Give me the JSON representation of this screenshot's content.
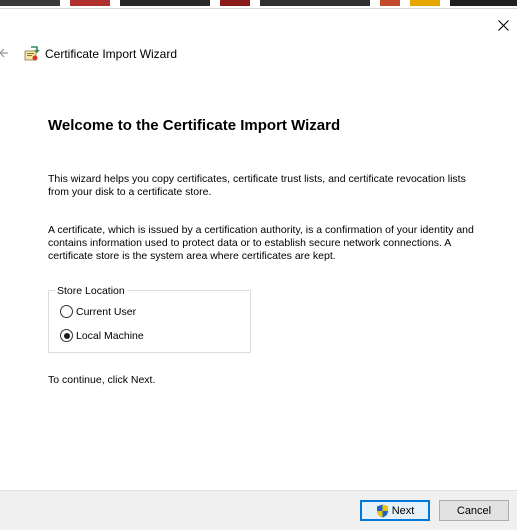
{
  "window": {
    "title": "Certificate Import Wizard",
    "close_icon": "close-icon",
    "back_icon": "back-arrow-icon",
    "wizard_icon": "certificate-wizard-icon"
  },
  "content": {
    "heading": "Welcome to the Certificate Import Wizard",
    "paragraph1": "This wizard helps you copy certificates, certificate trust lists, and certificate revocation lists from your disk to a certificate store.",
    "paragraph2": "A certificate, which is issued by a certification authority, is a confirmation of your identity and contains information used to protect data or to establish secure network connections. A certificate store is the system area where certificates are kept.",
    "store_location": {
      "legend": "Store Location",
      "options": [
        {
          "label": "Current User",
          "selected": false
        },
        {
          "label": "Local Machine",
          "selected": true
        }
      ]
    },
    "continue_text": "To continue, click Next."
  },
  "footer": {
    "next_label": "Next",
    "cancel_label": "Cancel",
    "next_icon": "uac-shield-icon"
  },
  "colors": {
    "accent": "#0078d7",
    "footer_bg": "#f0f0f0"
  }
}
